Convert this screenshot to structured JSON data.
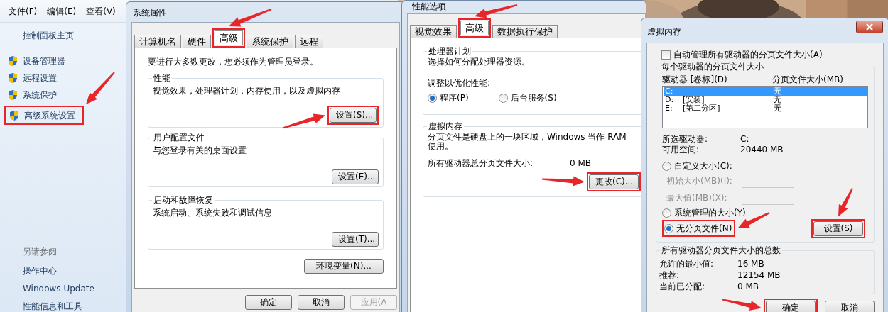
{
  "control_panel": {
    "menu": [
      "文件(F)",
      "编辑(E)",
      "查看(V)"
    ],
    "home_link": "控制面板主页",
    "tasks": [
      {
        "label": "设备管理器"
      },
      {
        "label": "远程设置"
      },
      {
        "label": "系统保护"
      },
      {
        "label": "高级系统设置"
      }
    ],
    "see_also_title": "另请参阅",
    "see_also": [
      "操作中心",
      "Windows Update",
      "性能信息和工具"
    ]
  },
  "system_properties": {
    "title": "系统属性",
    "tabs": [
      {
        "label": "计算机名",
        "selected": false
      },
      {
        "label": "硬件",
        "selected": false
      },
      {
        "label": "高级",
        "selected": true
      },
      {
        "label": "系统保护",
        "selected": false
      },
      {
        "label": "远程",
        "selected": false
      }
    ],
    "admin_note": "要进行大多数更改，您必须作为管理员登录。",
    "groups": [
      {
        "title": "性能",
        "description": "视觉效果，处理器计划，内存使用，以及虚拟内存",
        "button": "设置(S)..."
      },
      {
        "title": "用户配置文件",
        "description": "与您登录有关的桌面设置",
        "button": "设置(E)..."
      },
      {
        "title": "启动和故障恢复",
        "description": "系统启动、系统失败和调试信息",
        "button": "设置(T)..."
      }
    ],
    "env_button": "环境变量(N)...",
    "buttons": [
      {
        "label": "确定",
        "disabled": false
      },
      {
        "label": "取消",
        "disabled": false
      },
      {
        "label": "应用(A",
        "disabled": true
      }
    ]
  },
  "performance_options": {
    "title": "性能选项",
    "tabs": [
      {
        "label": "视觉效果",
        "selected": false
      },
      {
        "label": "高级",
        "selected": true
      },
      {
        "label": "数据执行保护",
        "selected": false
      }
    ],
    "processor_group": {
      "title": "处理器计划",
      "description": "选择如何分配处理器资源。",
      "adjust_label": "调整以优化性能:",
      "options": [
        {
          "label": "程序(P)",
          "selected": true
        },
        {
          "label": "后台服务(S)",
          "selected": false
        }
      ]
    },
    "virtual_memory_group": {
      "title": "虚拟内存",
      "description": "分页文件是硬盘上的一块区域，Windows 当作 RAM 使用。",
      "total_label": "所有驱动器总分页文件大小:",
      "total_value": "0 MB",
      "button": "更改(C)..."
    }
  },
  "virtual_memory": {
    "title": "虚拟内存",
    "auto_manage": {
      "label": "自动管理所有驱动器的分页文件大小(A)",
      "checked": false
    },
    "group_title": "每个驱动器的分页文件大小",
    "columns": [
      "驱动器 [卷标](D)",
      "分页文件大小(MB)"
    ],
    "drives": [
      {
        "drive": "C:",
        "size": "无",
        "selected": true
      },
      {
        "drive": "D:",
        "volume": "[安装]",
        "size": "无",
        "selected": false
      },
      {
        "drive": "E:",
        "volume": "[第二分区]",
        "size": "无",
        "selected": false
      }
    ],
    "selected_drive": {
      "label": "所选驱动器:",
      "value": "C:"
    },
    "free_space": {
      "label": "可用空间:",
      "value": "20440 MB"
    },
    "size_options": [
      {
        "kind": "radio",
        "label": "自定义大小(C):",
        "selected": false
      },
      {
        "kind": "field",
        "label": "初始大小(MB)(I):",
        "disabled": true
      },
      {
        "kind": "field",
        "label": "最大值(MB)(X):",
        "disabled": true
      },
      {
        "kind": "radio",
        "label": "系统管理的大小(Y)",
        "selected": false
      },
      {
        "kind": "radio",
        "label": "无分页文件(N)",
        "selected": true
      }
    ],
    "set_button": "设置(S)",
    "totals_title": "所有驱动器分页文件大小的总数",
    "totals": [
      {
        "label": "允许的最小值:",
        "value": "16 MB"
      },
      {
        "label": "推荐:",
        "value": "12154 MB"
      },
      {
        "label": "当前已分配:",
        "value": "0 MB"
      }
    ],
    "buttons": [
      "确定",
      "取消"
    ]
  }
}
